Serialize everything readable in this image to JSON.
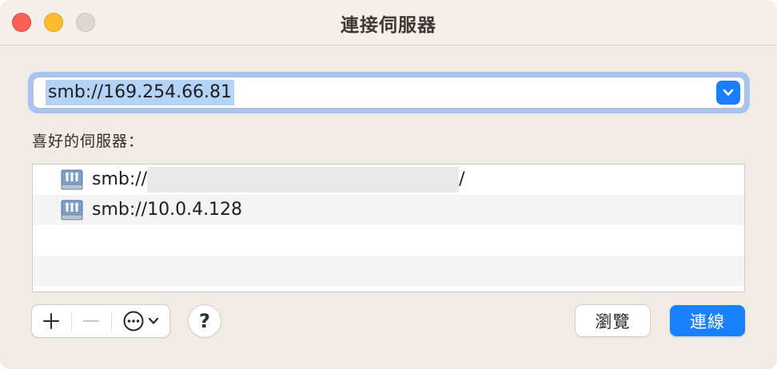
{
  "window": {
    "title": "連接伺服器"
  },
  "address": {
    "value": "smb://169.254.66.81"
  },
  "favorites": {
    "label": "喜好的伺服器：",
    "items": [
      {
        "prefix": "smb://",
        "suffix": "/",
        "redacted": true,
        "icon": "network-server-icon"
      },
      {
        "prefix": "smb://10.0.4.128",
        "suffix": "",
        "redacted": false,
        "icon": "network-server-icon"
      }
    ]
  },
  "toolbar": {
    "add_icon": "plus-icon",
    "remove_icon": "minus-icon",
    "more_icon": "ellipsis-circle-icon",
    "help_label": "?"
  },
  "buttons": {
    "browse_label": "瀏覽",
    "connect_label": "連線"
  },
  "colors": {
    "accent": "#1a80fc",
    "close": "#fe5f57",
    "minimize": "#febc2e",
    "zoom": "#ddd7d2",
    "selection": "#b5d2f7"
  }
}
